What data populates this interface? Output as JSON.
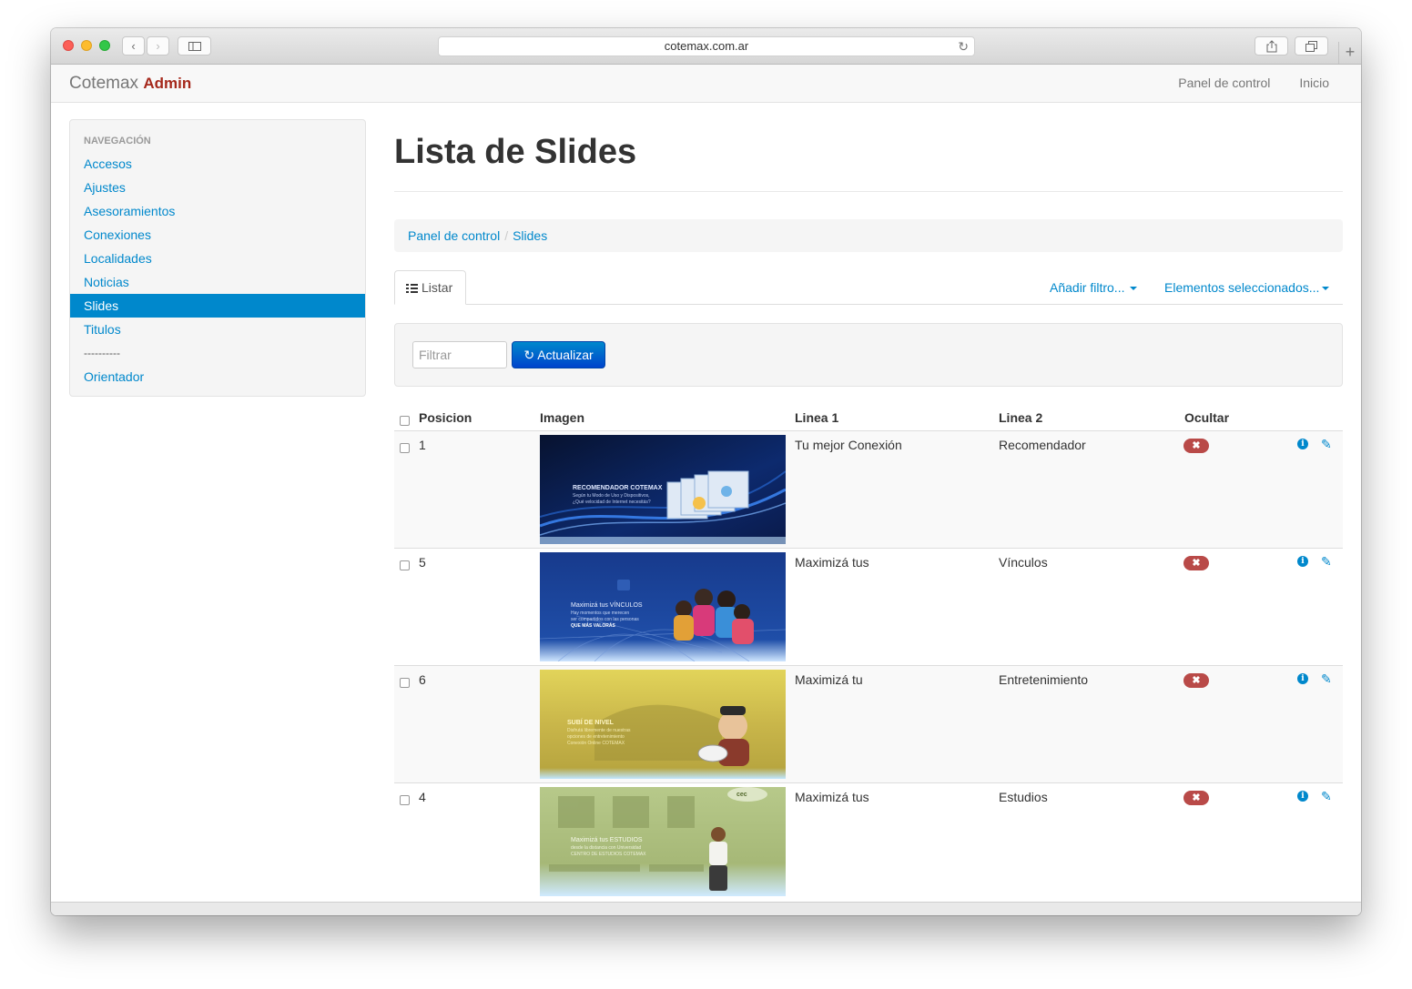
{
  "browser": {
    "url": "cotemax.com.ar"
  },
  "navbar": {
    "brand": "Cotemax",
    "brand_strong": "Admin",
    "links": [
      "Panel de control",
      "Inicio"
    ]
  },
  "sidebar": {
    "header": "NAVEGACIÓN",
    "items": [
      "Accesos",
      "Ajustes",
      "Asesoramientos",
      "Conexiones",
      "Localidades",
      "Noticias",
      "Slides",
      "Titulos"
    ],
    "separator": "----------",
    "extra_item": "Orientador",
    "active": "Slides"
  },
  "page": {
    "title": "Lista de Slides",
    "breadcrumb": [
      "Panel de control",
      "Slides"
    ],
    "tab_label": "Listar",
    "add_filter": "Añadir filtro...",
    "selected_elements": "Elementos seleccionados...",
    "filter_placeholder": "Filtrar",
    "refresh_label": "Actualizar"
  },
  "table": {
    "headers": [
      "Posicion",
      "Imagen",
      "Linea 1",
      "Linea 2",
      "Ocultar"
    ],
    "rows": [
      {
        "position": "1",
        "line1": "Tu mejor Conexión",
        "line2": "Recomendador",
        "hidden": false,
        "thumb": {
          "title": "RECOMENDADOR COTEMAX",
          "sub1": "Según tu Modo de Uso y Dispositivos,",
          "sub2": "¿Qué velocidad de Internet necesitás?"
        }
      },
      {
        "position": "5",
        "line1": "Maximizá tus",
        "line2": "Vínculos",
        "hidden": false,
        "thumb": {
          "title": "Maximizá tus VÍNCULOS",
          "sub1": "Hay momentos que merecen",
          "sub2": "ser compartidos con las personas",
          "sub3": "QUE MÁS VALORÁS"
        }
      },
      {
        "position": "6",
        "line1": "Maximizá tu",
        "line2": "Entretenimiento",
        "hidden": false,
        "thumb": {
          "title": "SUBÍ DE NIVEL",
          "sub1": "Disfrutá libremente de nuestras",
          "sub2": "opciones de entretenimiento",
          "sub3": "Conexión Online COTEMAX"
        }
      },
      {
        "position": "4",
        "line1": "Maximizá tus",
        "line2": "Estudios",
        "hidden": false,
        "thumb": {
          "title": "Maximizá tus ESTUDIOS",
          "sub1": "desde la distancia con Universidad",
          "sub2": "CENTRO DE ESTUDIOS COTEMAX",
          "logo": "cec"
        }
      }
    ]
  },
  "icons": {
    "hidden_badge": "x-icon",
    "info": "info-icon",
    "edit": "pencil-icon",
    "refresh": "refresh-icon",
    "list": "list-icon"
  },
  "colors": {
    "link": "#0088cc",
    "brand_accent": "#a5281b",
    "danger_badge": "#b94a48",
    "active_nav": "#0088cc"
  }
}
